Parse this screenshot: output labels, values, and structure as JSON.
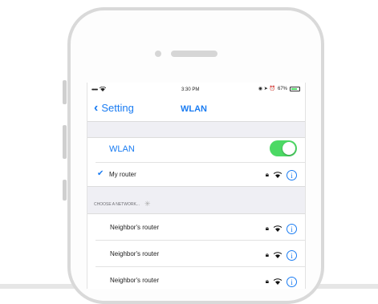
{
  "status_bar": {
    "signal_dots": "•••••",
    "wifi_icon": "wifi-icon",
    "time": "3:30 PM",
    "extras": "◉ ➤ ⏰",
    "battery": "67%"
  },
  "nav": {
    "back_label": "Setting",
    "title": "WLAN"
  },
  "wlan": {
    "label": "WLAN",
    "enabled": true,
    "connected_network": "My router"
  },
  "choose_section": {
    "header": "CHOOSE A NETWORK..."
  },
  "networks": [
    {
      "name": "Neighbor's router"
    },
    {
      "name": "Neighbor's router"
    },
    {
      "name": "Neighbor's router"
    }
  ],
  "colors": {
    "accent": "#1a7cf2",
    "toggle_on": "#4cd964"
  }
}
